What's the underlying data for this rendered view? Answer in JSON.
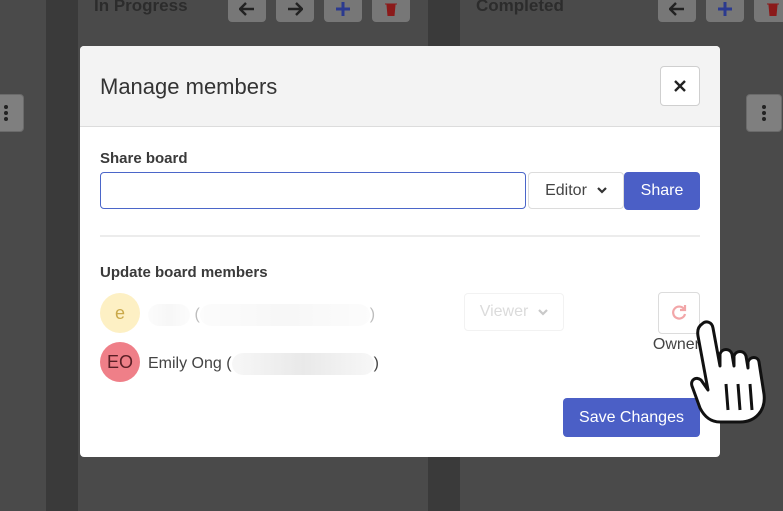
{
  "board": {
    "columns": [
      {
        "title": "In Progress"
      },
      {
        "title": "Completed"
      }
    ],
    "colors": {
      "delete": "#c62828",
      "add": "#3949ab"
    }
  },
  "modal": {
    "title": "Manage members",
    "close_icon": "close-icon",
    "share": {
      "label": "Share board",
      "input_value": "",
      "role_value": "Editor",
      "button_label": "Share"
    },
    "members": {
      "label": "Update board members",
      "list": [
        {
          "initials": "e",
          "name": "",
          "role_value": "Viewer",
          "avatar_color": "#fdf0c4",
          "initials_color": "#caa94a"
        },
        {
          "initials": "EO",
          "name": "Emily Ong",
          "role_label": "Owner",
          "avatar_color": "#ef7f88",
          "initials_color": "#5a1f25"
        }
      ]
    },
    "save_label": "Save Changes"
  },
  "accent_color": "#4b5fc6"
}
